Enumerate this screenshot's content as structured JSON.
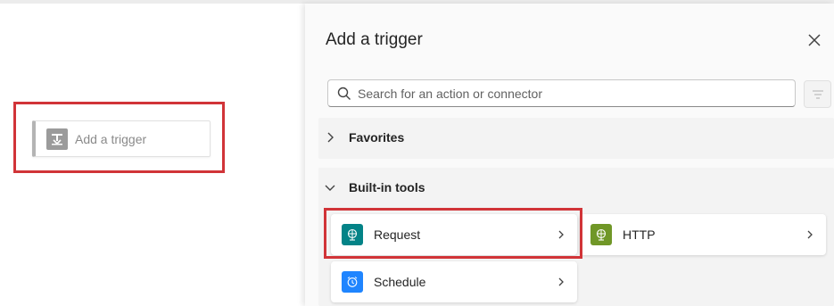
{
  "canvas": {
    "trigger_placeholder": "Add a trigger"
  },
  "panel": {
    "title": "Add a trigger",
    "search": {
      "placeholder": "Search for an action or connector",
      "value": ""
    },
    "sections": {
      "favorites": {
        "label": "Favorites",
        "expanded": false
      },
      "builtin": {
        "label": "Built-in tools",
        "expanded": true,
        "items": [
          {
            "label": "Request",
            "icon": "globe-icon",
            "color": "#038387"
          },
          {
            "label": "HTTP",
            "icon": "globe-icon",
            "color": "#709727"
          },
          {
            "label": "Schedule",
            "icon": "alarm-clock-icon",
            "color": "#1f85ff"
          }
        ]
      }
    }
  },
  "colors": {
    "highlight": "#d13438"
  }
}
